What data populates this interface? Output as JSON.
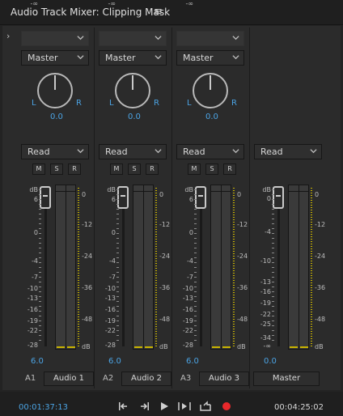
{
  "window": {
    "title": "Audio Track Mixer: Clipping Mask",
    "menu_icon": "hamburger-icon"
  },
  "channels": [
    {
      "id": "A1",
      "name": "Audio 1",
      "output": "Master",
      "automation": "Read",
      "pan_value": "0.0",
      "pan_left": "L",
      "pan_right": "R",
      "gain": "6.0",
      "has_input_selector": true,
      "has_pan": true,
      "has_msr": true
    },
    {
      "id": "A2",
      "name": "Audio 2",
      "output": "Master",
      "automation": "Read",
      "pan_value": "0.0",
      "pan_left": "L",
      "pan_right": "R",
      "gain": "6.0",
      "has_input_selector": true,
      "has_pan": true,
      "has_msr": true
    },
    {
      "id": "A3",
      "name": "Audio 3",
      "output": "Master",
      "automation": "Read",
      "pan_value": "0.0",
      "pan_left": "L",
      "pan_right": "R",
      "gain": "6.0",
      "has_input_selector": true,
      "has_pan": true,
      "has_msr": true
    },
    {
      "id": "",
      "name": "Master",
      "output": "",
      "automation": "Read",
      "pan_value": "",
      "pan_left": "",
      "pan_right": "",
      "gain": "0.0",
      "has_input_selector": false,
      "has_pan": false,
      "has_msr": false
    }
  ],
  "msr_labels": {
    "mute": "M",
    "solo": "S",
    "record": "R"
  },
  "fader_scale_track": [
    "dB",
    "6",
    "0",
    "-4",
    "-7",
    "-10",
    "-13",
    "-16",
    "-19",
    "-22",
    "-28",
    "-∞"
  ],
  "fader_scale_master": [
    "dB",
    "0",
    "-4",
    "-10",
    "-13",
    "-16",
    "-19",
    "-22",
    "-25",
    "-34",
    "-∞"
  ],
  "meter_scale": [
    "0",
    "-12",
    "-24",
    "-36",
    "-48",
    "dB"
  ],
  "transport": {
    "current_time": "00:01:37:13",
    "duration": "00:04:25:02",
    "buttons": [
      "go-to-in-icon",
      "go-to-out-icon",
      "play-icon",
      "play-in-to-out-icon",
      "loop-icon",
      "record-icon"
    ]
  },
  "colors": {
    "accent": "#4ba3e3",
    "record": "#e8282b",
    "meter_floor": "#c9b400"
  }
}
